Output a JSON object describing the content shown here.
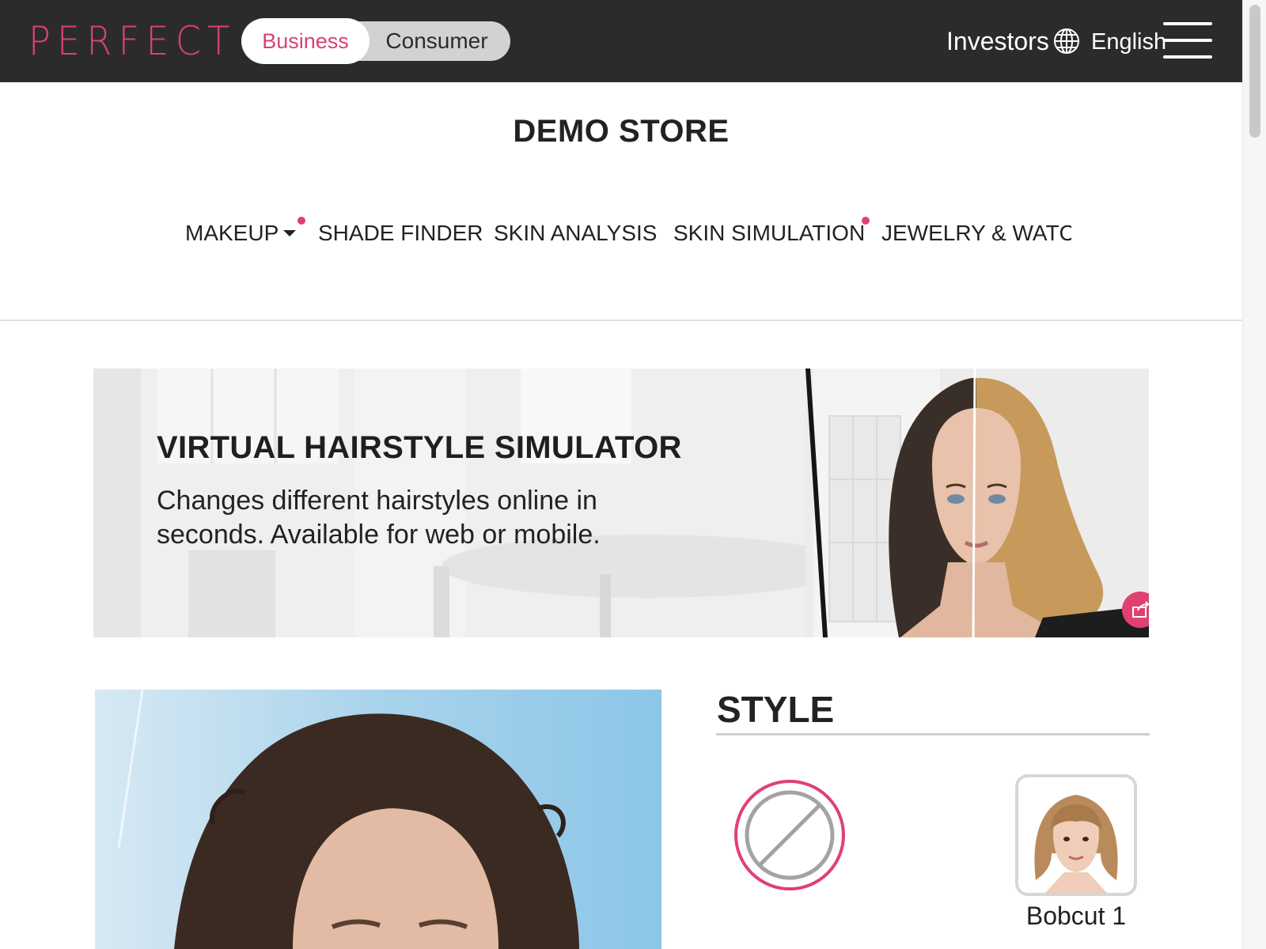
{
  "header": {
    "logo": "PERFECT",
    "toggle": {
      "active": "Business",
      "inactive": "Consumer"
    },
    "investors": "Investors",
    "language": "English"
  },
  "store": {
    "title": "DEMO STORE",
    "nav": [
      {
        "label": "MAKEUP",
        "has_dropdown": true,
        "has_dot": true
      },
      {
        "label": "SHADE FINDER"
      },
      {
        "label": "SKIN ANALYSIS"
      },
      {
        "label": "SKIN SIMULATION",
        "has_dot": true
      },
      {
        "label": "JEWELRY & WATCH"
      }
    ]
  },
  "banner": {
    "title": "VIRTUAL HAIRSTYLE SIMULATOR",
    "subtitle": "Changes different hairstyles online in seconds. Available for web or mobile."
  },
  "style_panel": {
    "title": "STYLE",
    "items": [
      {
        "label": "",
        "icon": "none-icon",
        "selected": true
      },
      {
        "label": "Bobcut 1",
        "icon": "bobcut-thumbnail",
        "selected": false
      }
    ]
  },
  "colors": {
    "brand_pink": "#e0416f",
    "topbar_bg": "#2b2b2c"
  }
}
